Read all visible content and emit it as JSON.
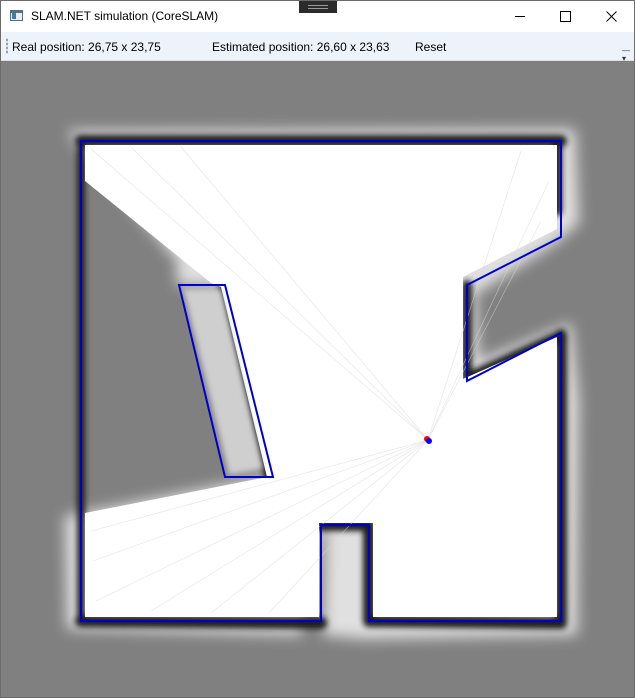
{
  "window": {
    "title": "SLAM.NET simulation (CoreSLAM)"
  },
  "toolbar": {
    "real_position": "Real position: 26,75 x 23,75",
    "estimated_position": "Estimated position: 26,60 x 23,63",
    "reset_label": "Reset"
  },
  "colors": {
    "map_background": "#808080",
    "free_space": "#ffffff",
    "wall_outline": "#0000cc",
    "real_robot": "#ff0000",
    "estimated_robot": "#0000ff"
  }
}
